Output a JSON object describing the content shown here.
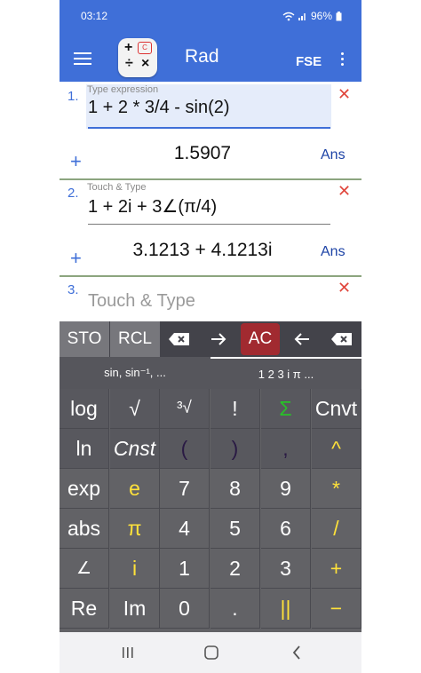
{
  "status": {
    "time": "03:12",
    "battery": "96%"
  },
  "appbar": {
    "title": "Rad",
    "mode": "FSE"
  },
  "entries": [
    {
      "num": "1.",
      "hint": "Type expression",
      "expr": "1 + 2 * 3/4 - sin(2)",
      "result": "1.5907",
      "ans": "Ans"
    },
    {
      "num": "2.",
      "hint": "Touch & Type",
      "expr": "1 + 2i + 3∠(π/4)",
      "result": "3.1213 + 4.1213i",
      "ans": "Ans"
    },
    {
      "num": "3.",
      "placeholder": "Touch & Type"
    }
  ],
  "toolbar": {
    "sto": "STO",
    "rcl": "RCL",
    "ac": "AC"
  },
  "tabs": [
    "sin, sin⁻¹, ...",
    "1 2 3 i π ..."
  ],
  "keys": [
    [
      "log",
      "√",
      "³√",
      "!",
      "Σ",
      "Cnvt"
    ],
    [
      "ln",
      "Cnst",
      "(",
      ")",
      ",",
      "^"
    ],
    [
      "exp",
      "e",
      "7",
      "8",
      "9",
      "*"
    ],
    [
      "abs",
      "π",
      "4",
      "5",
      "6",
      "/"
    ],
    [
      "∠",
      "i",
      "1",
      "2",
      "3",
      "+"
    ],
    [
      "Re",
      "Im",
      "0",
      ".",
      "||",
      "−"
    ]
  ]
}
